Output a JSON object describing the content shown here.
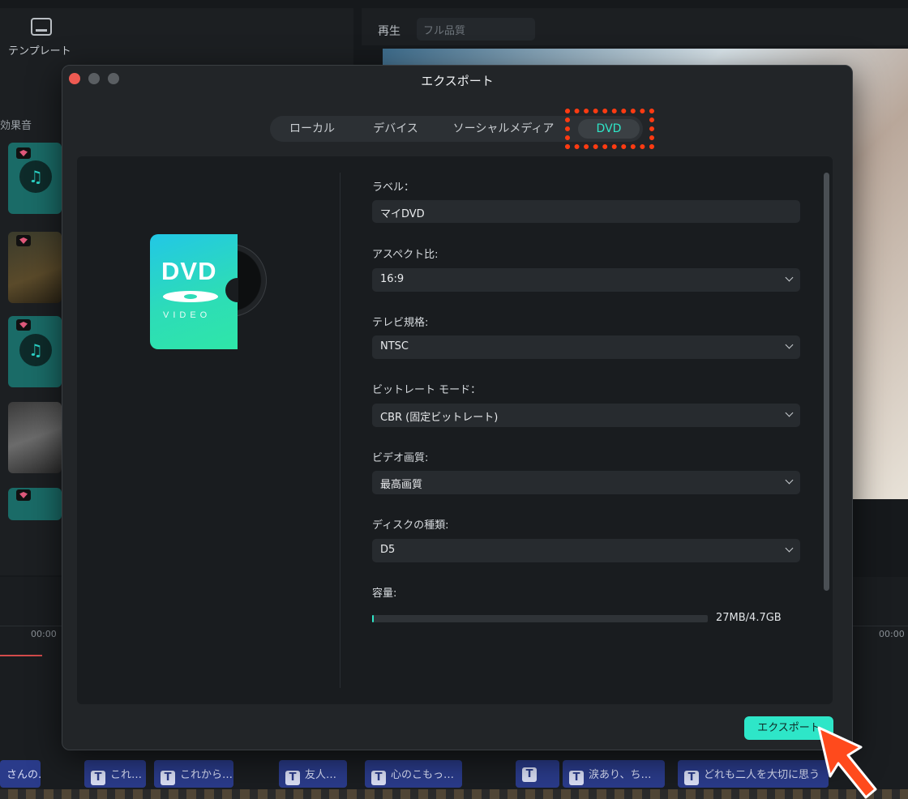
{
  "background": {
    "sidebar": {
      "template_label": "テンプレート",
      "effects_label": "効果音"
    },
    "preview_header": {
      "play_label": "再生",
      "quality_value": "フル品質"
    },
    "timeline": {
      "time_left": "00:00",
      "time_right": "00:00"
    },
    "captions": [
      {
        "text": "さんの…",
        "has_t": false
      },
      {
        "text": "これ…",
        "has_t": true
      },
      {
        "text": "これから…",
        "has_t": true
      },
      {
        "text": "友人…",
        "has_t": true
      },
      {
        "text": "心のこもっ…",
        "has_t": true
      },
      {
        "text": "",
        "has_t": true
      },
      {
        "text": "涙あり、ち…",
        "has_t": true
      },
      {
        "text": "どれも二人を大切に思う",
        "has_t": true
      }
    ]
  },
  "dialog": {
    "title": "エクスポート",
    "tabs": [
      {
        "label": "ローカル",
        "active": false
      },
      {
        "label": "デバイス",
        "active": false
      },
      {
        "label": "ソーシャルメディア",
        "active": false
      },
      {
        "label": "DVD",
        "active": true
      }
    ],
    "logo": {
      "big_text": "DVD",
      "small_text": "VIDEO"
    },
    "fields": {
      "label": {
        "label": "ラベル：",
        "value": "マイDVD"
      },
      "aspect": {
        "label": "アスペクト比:",
        "value": "16:9"
      },
      "tv_standard": {
        "label": "テレビ規格:",
        "value": "NTSC"
      },
      "bitrate_mode": {
        "label": "ビットレート モード：",
        "value": "CBR (固定ビットレート)"
      },
      "video_quality": {
        "label": "ビデオ画質:",
        "value": "最高画質"
      },
      "disc_type": {
        "label": "ディスクの種類:",
        "value": "D5"
      },
      "capacity": {
        "label": "容量:",
        "value": "27MB/4.7GB",
        "fill_fraction": 0.006
      }
    },
    "export_button": "エクスポート"
  },
  "colors": {
    "accent": "#2ee6c8",
    "highlight": "#ff3b12"
  }
}
